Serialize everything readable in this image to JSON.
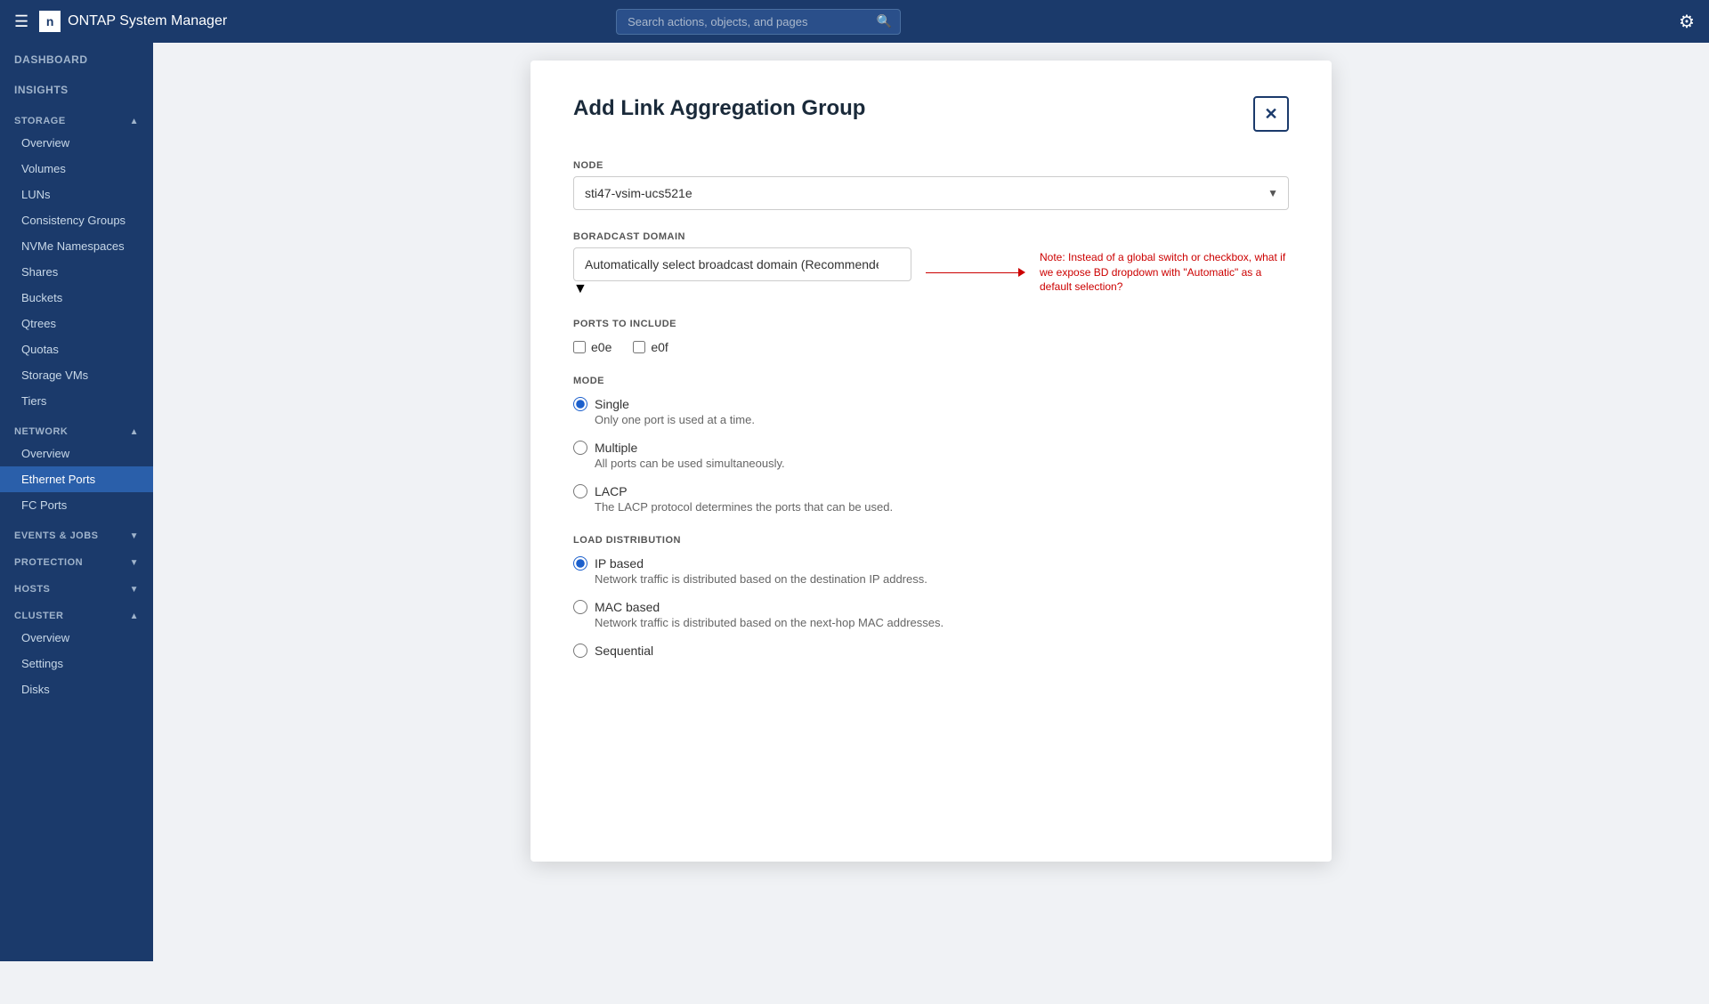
{
  "header": {
    "menu_icon": "☰",
    "logo_icon": "n",
    "title": "ONTAP System Manager",
    "search_placeholder": "Search actions, objects, and pages",
    "settings_icon": "⚙"
  },
  "sidebar": {
    "nav_sections": [
      {
        "id": "top",
        "items": [
          {
            "id": "dashboard",
            "label": "DASHBOARD",
            "type": "header-item",
            "active": false
          },
          {
            "id": "insights",
            "label": "INSIGHTS",
            "type": "header-item",
            "active": false
          }
        ]
      },
      {
        "id": "storage",
        "label": "STORAGE",
        "collapsed": false,
        "items": [
          {
            "id": "overview",
            "label": "Overview"
          },
          {
            "id": "volumes",
            "label": "Volumes"
          },
          {
            "id": "luns",
            "label": "LUNs"
          },
          {
            "id": "consistency-groups",
            "label": "Consistency Groups"
          },
          {
            "id": "nvme-namespaces",
            "label": "NVMe Namespaces"
          },
          {
            "id": "shares",
            "label": "Shares"
          },
          {
            "id": "buckets",
            "label": "Buckets"
          },
          {
            "id": "qtrees",
            "label": "Qtrees"
          },
          {
            "id": "quotas",
            "label": "Quotas"
          },
          {
            "id": "storage-vms",
            "label": "Storage VMs"
          },
          {
            "id": "tiers",
            "label": "Tiers"
          }
        ]
      },
      {
        "id": "network",
        "label": "NETWORK",
        "collapsed": false,
        "items": [
          {
            "id": "net-overview",
            "label": "Overview"
          },
          {
            "id": "ethernet-ports",
            "label": "Ethernet Ports",
            "active": true
          },
          {
            "id": "fc-ports",
            "label": "FC Ports"
          }
        ]
      },
      {
        "id": "events-jobs",
        "label": "EVENTS & JOBS",
        "collapsed": false,
        "items": []
      },
      {
        "id": "protection",
        "label": "PROTECTION",
        "collapsed": false,
        "items": []
      },
      {
        "id": "hosts",
        "label": "HOSTS",
        "collapsed": false,
        "items": []
      },
      {
        "id": "cluster",
        "label": "CLUSTER",
        "collapsed": false,
        "items": [
          {
            "id": "cluster-overview",
            "label": "Overview"
          },
          {
            "id": "cluster-settings",
            "label": "Settings"
          },
          {
            "id": "cluster-disks",
            "label": "Disks"
          }
        ]
      }
    ]
  },
  "modal": {
    "title": "Add Link Aggregation Group",
    "close_label": "✕",
    "node_label": "NODE",
    "node_value": "sti47-vsim-ucs521e",
    "node_options": [
      "sti47-vsim-ucs521e"
    ],
    "broadcast_domain_label": "BORADCAST DOMAIN",
    "broadcast_domain_value": "Automatically select broadcast domain (Recommended)",
    "broadcast_domain_note": "Note: Instead of a global switch or checkbox, what if we expose BD dropdown with \"Automatic\" as a default selection?",
    "ports_label": "PORTS TO INCLUDE",
    "ports": [
      {
        "id": "e0e",
        "label": "e0e",
        "checked": false
      },
      {
        "id": "e0f",
        "label": "e0f",
        "checked": false
      }
    ],
    "mode_label": "MODE",
    "modes": [
      {
        "id": "single",
        "label": "Single",
        "desc": "Only one port is used at a time.",
        "checked": true
      },
      {
        "id": "multiple",
        "label": "Multiple",
        "desc": "All ports can be used simultaneously.",
        "checked": false
      },
      {
        "id": "lacp",
        "label": "LACP",
        "desc": "The LACP protocol determines the ports that can be used.",
        "checked": false
      }
    ],
    "load_dist_label": "LOAD DISTRIBUTION",
    "load_dists": [
      {
        "id": "ip-based",
        "label": "IP based",
        "desc": "Network traffic is distributed based on the destination IP address.",
        "checked": true
      },
      {
        "id": "mac-based",
        "label": "MAC based",
        "desc": "Network traffic is distributed based on the next-hop MAC addresses.",
        "checked": false
      },
      {
        "id": "sequential",
        "label": "Sequential",
        "desc": "",
        "checked": false
      }
    ]
  }
}
